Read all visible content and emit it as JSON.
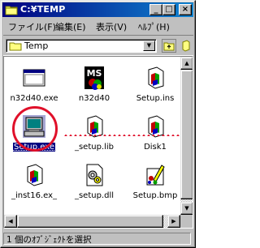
{
  "window": {
    "title": "C:¥TEMP",
    "minimize_label": "_",
    "maximize_label": "□",
    "close_label": "×"
  },
  "menu": {
    "items": [
      "ファイル(F)",
      "編集(E)",
      "表示(V)",
      "ﾍﾙﾌﾟ(H)"
    ]
  },
  "toolbar": {
    "address_value": "Temp"
  },
  "files": [
    {
      "label": "n32d40.exe",
      "icon": "app-exe-icon"
    },
    {
      "label": "n32d40",
      "icon": "ms-dos-icon"
    },
    {
      "label": "Setup.ins",
      "icon": "setup-icon"
    },
    {
      "label": "Setup.exe",
      "icon": "computer-icon",
      "selected": true
    },
    {
      "label": "_setup.lib",
      "icon": "setup-icon"
    },
    {
      "label": "Disk1",
      "icon": "setup-icon"
    },
    {
      "label": "_inst16.ex_",
      "icon": "setup-icon"
    },
    {
      "label": "_setup.dll",
      "icon": "gear-file-icon"
    },
    {
      "label": "Setup.bmp",
      "icon": "paint-icon"
    }
  ],
  "status": {
    "text": "1 個のｵﾌﾞｼﾞｪｸﾄを選択"
  },
  "colors": {
    "title_bar": "#000080",
    "highlight": "#e0102a",
    "face": "#c0c0c0"
  }
}
